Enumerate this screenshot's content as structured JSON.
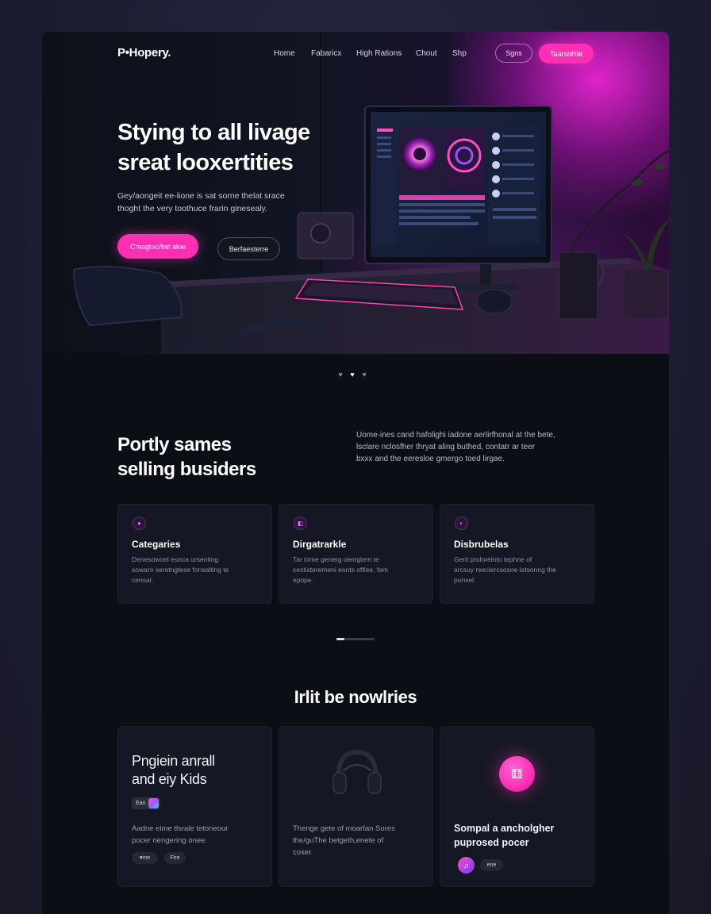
{
  "nav": {
    "logo": "P•Hopery.",
    "links": [
      "Home",
      "Fabaricx",
      "High Rations",
      "Chout",
      "Shp"
    ],
    "signin_label": "Sgns",
    "cta_label": "Taarsnfitie"
  },
  "hero": {
    "title_lines": [
      "Stying to all livage",
      "sreat looxertities"
    ],
    "subtitle_lines": [
      "Gey/aongeit ee-lione is sat sorne thelat srace",
      "thoght the very toothuce frarin ginesealy."
    ],
    "primary_button": "Cmagteo/lnit aloe",
    "secondary_button": "Berfaesterre",
    "carousel_dots": [
      "♥",
      "♥",
      "♥"
    ],
    "carousel_active": 1
  },
  "section_two": {
    "title_lines": [
      "Portly sames",
      "selling busiders"
    ],
    "desc_lines": [
      "Uome-ines cand hafolighi iadone aerlirfhonal at the bete,",
      "lsclare nclosfher thryat aling buthed, contatr ar teer",
      "bxxx and the eeresloe gmergo toed lirgae."
    ],
    "cards": [
      {
        "icon": "●",
        "title": "Categaries",
        "body": [
          "Denesowoel esnca ursenting",
          "sowaro seretngtese fonsalting te",
          "censar."
        ]
      },
      {
        "icon": "◧",
        "title": "Dirgatrarkle",
        "body": [
          "Tar iome generg oemgtem te",
          "cestisteremeni eonts oftlee, fam",
          "epope."
        ]
      },
      {
        "icon": "◐",
        "title": "Disbrubelas",
        "body": [
          "Genl proloreinto tephne of",
          "arcsuy reeclercsosne latsonng the",
          "ponsel."
        ]
      }
    ]
  },
  "section_three": {
    "title": "Irlit be nowlries",
    "card_one": {
      "title_lines": [
        "Pngiein anrall",
        "and eiy Kids"
      ],
      "chip_label": "Ean",
      "body_lines": [
        "Aadne eime tlsrale tetoneour",
        "pocer nengering onee."
      ],
      "tags": [
        "♥ine",
        "Fire"
      ]
    },
    "card_two": {
      "body_lines": [
        "Thenge gete of moarfan Sores",
        "the/guThe betgeth,enete of",
        "coser."
      ]
    },
    "card_three": {
      "icon": "⚅",
      "title_lines": [
        "Sompal a ancholgher",
        "puprosed pocer"
      ],
      "avatar": "♫",
      "tag": "ene"
    }
  },
  "colors": {
    "accent": "#ff2fb4",
    "background": "#0c0e16",
    "card": "#151824",
    "outer": "#1e1e33"
  }
}
